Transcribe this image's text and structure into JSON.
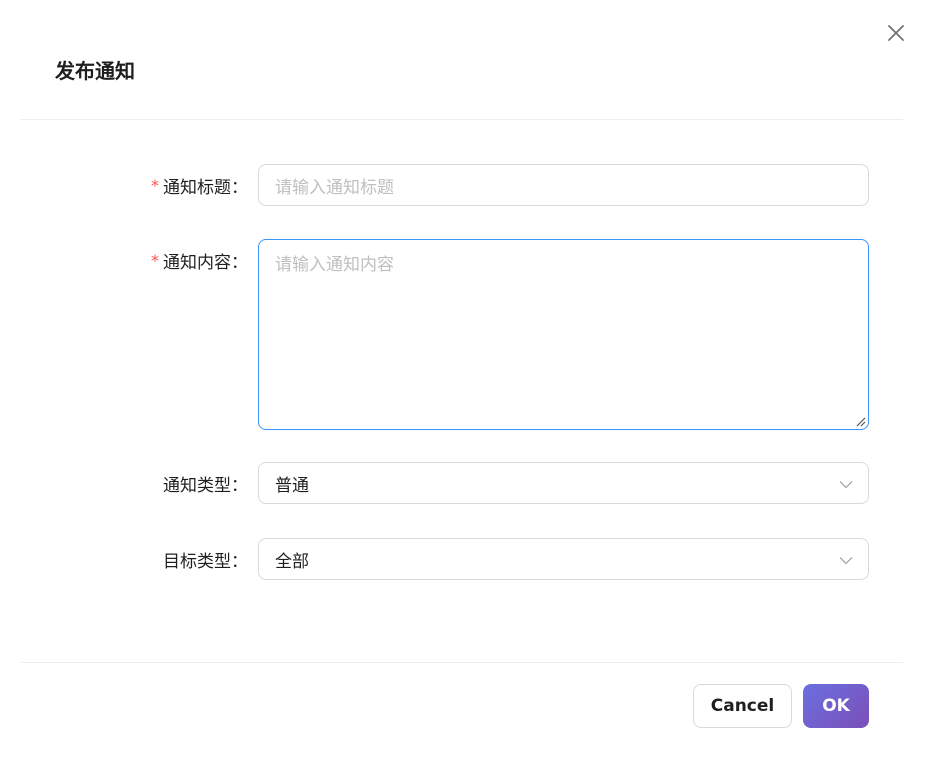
{
  "modal": {
    "title": "发布通知",
    "close_icon": "close-icon"
  },
  "form": {
    "fields": [
      {
        "label": "通知标题",
        "colon": "：",
        "required": true,
        "placeholder": "请输入通知标题",
        "value": ""
      },
      {
        "label": "通知内容",
        "colon": "：",
        "required": true,
        "placeholder": "请输入通知内容",
        "value": ""
      },
      {
        "label": "通知类型",
        "colon": "：",
        "required": false,
        "selected": "普通",
        "icon": "chevron-down-icon"
      },
      {
        "label": "目标类型",
        "colon": "：",
        "required": false,
        "selected": "全部",
        "icon": "chevron-down-icon"
      }
    ],
    "required_mark": "*"
  },
  "footer": {
    "cancel_label": "Cancel",
    "ok_label": "OK"
  },
  "colors": {
    "required": "#ff4d4f",
    "focus_border": "#4096ff",
    "ok_gradient_start": "#6b6fe0",
    "ok_gradient_end": "#7b4fb8"
  }
}
